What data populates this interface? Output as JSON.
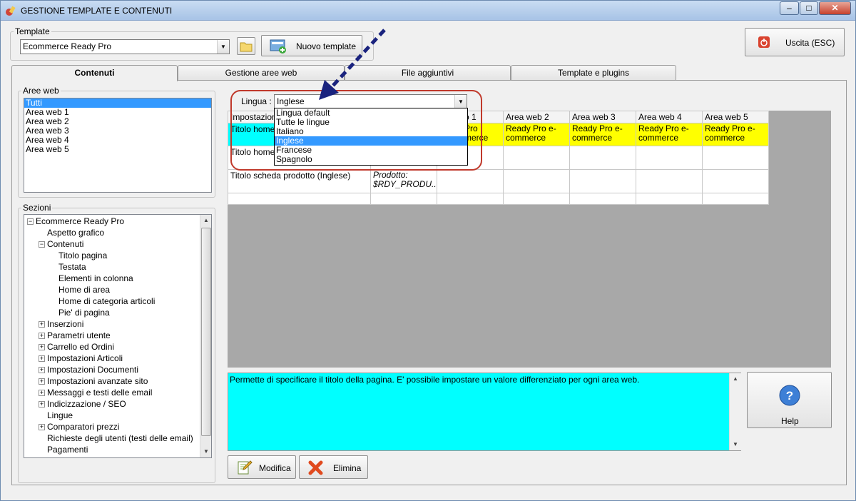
{
  "window": {
    "title": "GESTIONE TEMPLATE E CONTENUTI",
    "controls": {
      "minimize": "–",
      "maximize": "□",
      "close": "✕"
    }
  },
  "template": {
    "legend": "Template",
    "selected": "Ecommerce Ready Pro",
    "new_button": "Nuovo template",
    "exit_button": "Uscita (ESC)"
  },
  "tabs": [
    "Contenuti",
    "Gestione aree web",
    "File aggiuntivi",
    "Template e plugins"
  ],
  "aree_web": {
    "legend": "Aree web",
    "items": [
      "Tutti",
      "Area web 1",
      "Area web 2",
      "Area web 3",
      "Area web 4",
      "Area web 5"
    ]
  },
  "sezioni": {
    "legend": "Sezioni",
    "nodes": [
      {
        "label": "Ecommerce Ready Pro",
        "exp": "⊟",
        "level": 0
      },
      {
        "label": "Aspetto grafico",
        "exp": "",
        "level": 1
      },
      {
        "label": "Contenuti",
        "exp": "⊟",
        "level": 1
      },
      {
        "label": "Titolo pagina",
        "exp": "",
        "level": 2
      },
      {
        "label": "Testata",
        "exp": "",
        "level": 2
      },
      {
        "label": "Elementi in colonna",
        "exp": "",
        "level": 2
      },
      {
        "label": "Home di area",
        "exp": "",
        "level": 2
      },
      {
        "label": "Home di categoria articoli",
        "exp": "",
        "level": 2
      },
      {
        "label": "Pie' di pagina",
        "exp": "",
        "level": 2
      },
      {
        "label": "Inserzioni",
        "exp": "⊞",
        "level": 1
      },
      {
        "label": "Parametri utente",
        "exp": "⊞",
        "level": 1
      },
      {
        "label": "Carrello ed Ordini",
        "exp": "⊞",
        "level": 1
      },
      {
        "label": "Impostazioni Articoli",
        "exp": "⊞",
        "level": 1
      },
      {
        "label": "Impostazioni Documenti",
        "exp": "⊞",
        "level": 1
      },
      {
        "label": "Impostazioni avanzate sito",
        "exp": "⊞",
        "level": 1
      },
      {
        "label": "Messaggi e testi delle email",
        "exp": "⊞",
        "level": 1
      },
      {
        "label": "Indicizzazione / SEO",
        "exp": "⊞",
        "level": 1
      },
      {
        "label": "Lingue",
        "exp": "",
        "level": 1
      },
      {
        "label": "Comparatori prezzi",
        "exp": "⊞",
        "level": 1
      },
      {
        "label": "Richieste degli utenti (testi delle email)",
        "exp": "",
        "level": 1
      },
      {
        "label": "Pagamenti",
        "exp": "",
        "level": 1
      }
    ]
  },
  "lingua": {
    "label": "Lingua :",
    "selected": "Inglese",
    "options": [
      "Lingua default",
      "Tutte le lingue",
      "Italiano",
      "Inglese",
      "Francese",
      "Spagnolo"
    ]
  },
  "grid": {
    "headers": [
      "Impostazione",
      "",
      "Area web 1",
      "Area web 2",
      "Area web 3",
      "Area web 4",
      "Area web 5"
    ],
    "header_partial_1": "b 1",
    "rows": [
      {
        "label": "Titolo home di",
        "cells": [
          "",
          "Ready Pro e-commerce",
          "Ready Pro e-commerce",
          "Ready Pro e-commerce",
          "Ready Pro e-commerce",
          "Ready Pro e-commerce"
        ]
      },
      {
        "label": "Titolo home di",
        "cells": [
          "",
          "",
          "",
          "",
          "",
          ""
        ]
      },
      {
        "label": "Titolo scheda prodotto (Inglese)",
        "cells": [
          "Prodotto: $RDY_PRODU...",
          "",
          "",
          "",
          "",
          ""
        ]
      }
    ],
    "row1_partial": "Pro",
    "row1_partial2": "merce"
  },
  "description": "Permette di specificare il titolo della pagina. E' possibile impostare un valore differenziato per ogni area web.",
  "buttons": {
    "modifica": "Modifica",
    "elimina": "Elimina",
    "help": "Help"
  }
}
